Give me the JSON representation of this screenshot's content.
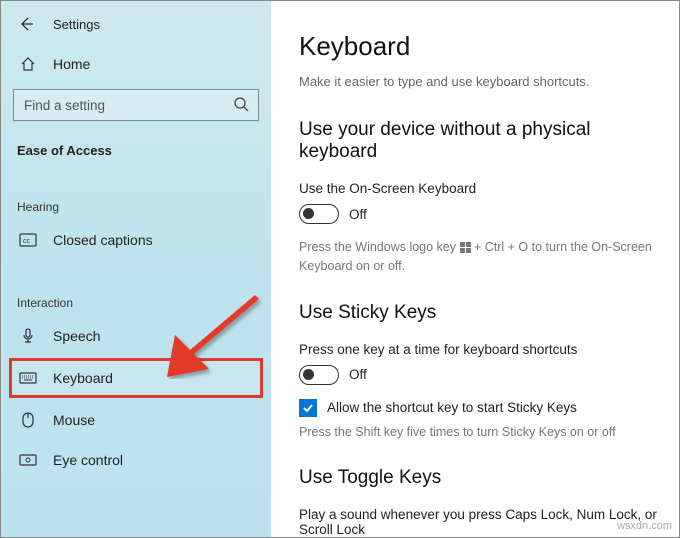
{
  "header": {
    "app": "Settings"
  },
  "sidebar": {
    "home": "Home",
    "search_placeholder": "Find a setting",
    "group": "Ease of Access",
    "cat_hearing": "Hearing",
    "cat_interaction": "Interaction",
    "items": {
      "closed_captions": "Closed captions",
      "speech": "Speech",
      "keyboard": "Keyboard",
      "mouse": "Mouse",
      "eye_control": "Eye control"
    }
  },
  "main": {
    "title": "Keyboard",
    "subtitle": "Make it easier to type and use keyboard shortcuts.",
    "s1": {
      "title": "Use your device without a physical keyboard",
      "label": "Use the On-Screen Keyboard",
      "state": "Off",
      "hint_a": "Press the Windows logo key ",
      "hint_b": " + Ctrl + O to turn the On-Screen Keyboard on or off."
    },
    "s2": {
      "title": "Use Sticky Keys",
      "label": "Press one key at a time for keyboard shortcuts",
      "state": "Off",
      "check_label": "Allow the shortcut key to start Sticky Keys",
      "hint": "Press the Shift key five times to turn Sticky Keys on or off"
    },
    "s3": {
      "title": "Use Toggle Keys",
      "label": "Play a sound whenever you press Caps Lock, Num Lock, or Scroll Lock"
    }
  },
  "watermark": "wsxdn.com"
}
